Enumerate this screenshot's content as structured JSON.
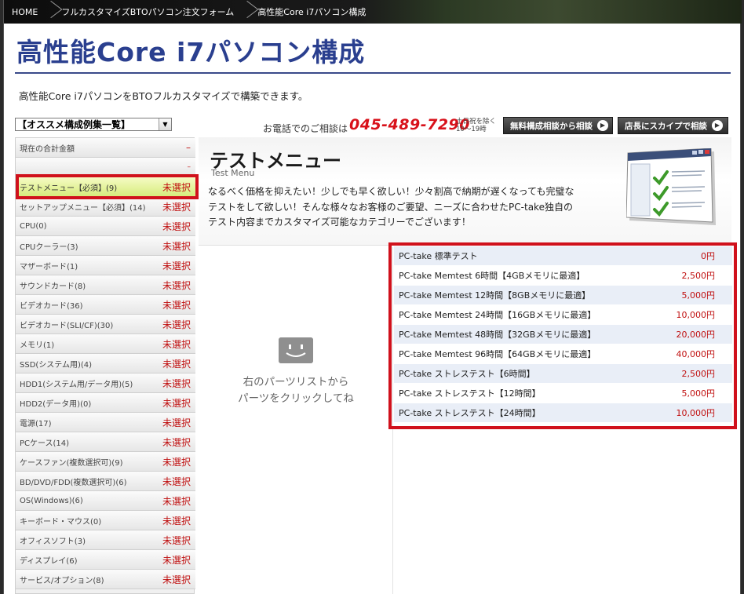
{
  "breadcrumb": {
    "items": [
      "HOME",
      "フルカスタマイズBTOパソコン注文フォーム",
      "高性能Core i7パソコン構成"
    ]
  },
  "page": {
    "title": "高性能Core i7パソコン構成",
    "intro": "高性能Core i7パソコンをBTOフルカスタマイズで構築できます。"
  },
  "preset_select": {
    "value": "【オススメ構成例集一覧】"
  },
  "contact": {
    "phone_label": "お電話でのご相談は",
    "phone_number": "045-489-7290",
    "hours_line1": "土日祝を除く",
    "hours_line2": "10〜19時",
    "free_consult_button": "無料構成相談から相談",
    "skype_button": "店長にスカイプで相談"
  },
  "sidebar": {
    "total_label": "現在の合計金額",
    "total_value": "–",
    "blank_value": "–",
    "items": [
      {
        "label": "テストメニュー【必須】(9)",
        "status": "未選択"
      },
      {
        "label": "セットアップメニュー【必須】(14)",
        "status": "未選択"
      },
      {
        "label": "CPU(0)",
        "status": "未選択"
      },
      {
        "label": "CPUクーラー(3)",
        "status": "未選択"
      },
      {
        "label": "マザーボード(1)",
        "status": "未選択"
      },
      {
        "label": "サウンドカード(8)",
        "status": "未選択"
      },
      {
        "label": "ビデオカード(36)",
        "status": "未選択"
      },
      {
        "label": "ビデオカード(SLI/CF)(30)",
        "status": "未選択"
      },
      {
        "label": "メモリ(1)",
        "status": "未選択"
      },
      {
        "label": "SSD(システム用)(4)",
        "status": "未選択"
      },
      {
        "label": "HDD1(システム用/データ用)(5)",
        "status": "未選択"
      },
      {
        "label": "HDD2(データ用)(0)",
        "status": "未選択"
      },
      {
        "label": "電源(17)",
        "status": "未選択"
      },
      {
        "label": "PCケース(14)",
        "status": "未選択"
      },
      {
        "label": "ケースファン(複数選択可)(9)",
        "status": "未選択"
      },
      {
        "label": "BD/DVD/FDD(複数選択可)(6)",
        "status": "未選択"
      },
      {
        "label": "OS(Windows)(6)",
        "status": "未選択"
      },
      {
        "label": "キーボード・マウス(0)",
        "status": "未選択"
      },
      {
        "label": "オフィスソフト(3)",
        "status": "未選択"
      },
      {
        "label": "ディスプレイ(6)",
        "status": "未選択"
      },
      {
        "label": "サービス/オプション(8)",
        "status": "未選択"
      }
    ]
  },
  "menu": {
    "title": "テストメニュー",
    "subtitle": "Test Menu",
    "description": "なるべく価格を抑えたい！少しでも早く欲しい！少々割高で納期が遅くなっても完璧なテストをして欲しい！そんな様々なお客様のご要望、ニーズに合わせたPC-take独自のテスト内容までカスタマイズ可能なカテゴリーでございます！"
  },
  "empty_state": {
    "line1": "右のパーツリストから",
    "line2": "パーツをクリックしてね"
  },
  "parts": [
    {
      "name": "PC-take 標準テスト",
      "price": "0円"
    },
    {
      "name": "PC-take Memtest 6時間【4GBメモリに最適】",
      "price": "2,500円"
    },
    {
      "name": "PC-take Memtest 12時間【8GBメモリに最適】",
      "price": "5,000円"
    },
    {
      "name": "PC-take Memtest 24時間【16GBメモリに最適】",
      "price": "10,000円"
    },
    {
      "name": "PC-take Memtest 48時間【32GBメモリに最適】",
      "price": "20,000円"
    },
    {
      "name": "PC-take Memtest 96時間【64GBメモリに最適】",
      "price": "40,000円"
    },
    {
      "name": "PC-take ストレステスト【6時間】",
      "price": "2,500円"
    },
    {
      "name": "PC-take ストレステスト【12時間】",
      "price": "5,000円"
    },
    {
      "name": "PC-take ストレステスト【24時間】",
      "price": "10,000円"
    }
  ],
  "colors": {
    "title_blue": "#2a3f8f",
    "status_red": "#c01010",
    "highlight_red": "#d0111c",
    "active_green": "#d6ec7c"
  }
}
